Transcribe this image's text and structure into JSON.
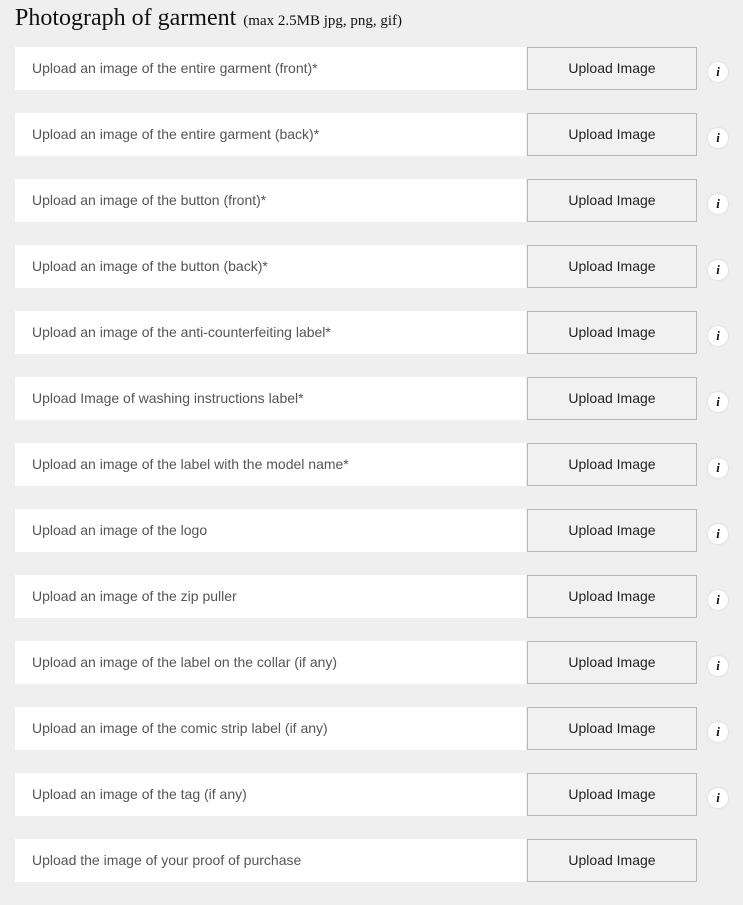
{
  "header": {
    "title": "Photograph of garment",
    "subtitle": "(max 2.5MB jpg, png, gif)"
  },
  "info_icon": {
    "glyph": "i",
    "icon": "info-icon"
  },
  "rows": [
    {
      "label": "Upload an image of the entire garment (front)*",
      "button": "Upload Image",
      "info": true
    },
    {
      "label": "Upload an image of the entire garment (back)*",
      "button": "Upload Image",
      "info": true
    },
    {
      "label": "Upload an image of the button (front)*",
      "button": "Upload Image",
      "info": true
    },
    {
      "label": "Upload an image of the button (back)*",
      "button": "Upload Image",
      "info": true
    },
    {
      "label": "Upload an image of the anti-counterfeiting label*",
      "button": "Upload Image",
      "info": true
    },
    {
      "label": "Upload Image of washing instructions label*",
      "button": "Upload Image",
      "info": true
    },
    {
      "label": "Upload an image of the label with the model name*",
      "button": "Upload Image",
      "info": true
    },
    {
      "label": "Upload an image of the logo",
      "button": "Upload Image",
      "info": true
    },
    {
      "label": "Upload an image of the zip puller",
      "button": "Upload Image",
      "info": true
    },
    {
      "label": "Upload an image of the label on the collar (if any)",
      "button": "Upload Image",
      "info": true
    },
    {
      "label": "Upload an image of the comic strip label (if any)",
      "button": "Upload Image",
      "info": true
    },
    {
      "label": "Upload an image of the tag (if any)",
      "button": "Upload Image",
      "info": true
    },
    {
      "label": "Upload the image of your proof of purchase",
      "button": "Upload Image",
      "info": false
    }
  ]
}
